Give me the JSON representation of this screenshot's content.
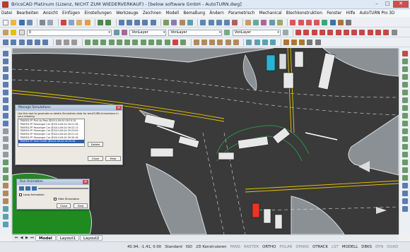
{
  "window": {
    "title": "BricsCAD Platinum (Lizenz, NICHT ZUM WIEDERVERKAUF) - [below software GmbH - AutoTURN.dwg]",
    "minimize_glyph": "–",
    "maximize_glyph": "□",
    "close_glyph": "✕"
  },
  "menu": [
    "Datei",
    "Bearbeiten",
    "Ansicht",
    "Einfügen",
    "Einstellungen",
    "Werkzeuge",
    "Zeichnen",
    "Modell",
    "Bemaßung",
    "Ändern",
    "Parametrisch",
    "Mechanical",
    "Blechkonstruktion",
    "Fenster",
    "Hilfe",
    "AutoTURN Pro 3D"
  ],
  "toolbar": {
    "layer_value": "0",
    "color_value": "VonLayer",
    "linetype_value": "VonLayer",
    "lineweight_value": "VonLayer"
  },
  "dialog_simulations": {
    "title": "Manage Simulations",
    "close_glyph": "✕",
    "description": "Use this tool to generate or delete Simulation data for AutoTURN Animations in your drawing.",
    "items": [
      "TRAREG-PF Pick Up Pass @2014-09-04 09:19:10",
      "TRAREG-PF Passenger Car @2014-09-04 09:21:38",
      "TRAREG-PF Passenger Car @2014-09-04 09:22:13",
      "TRAREG-PF Passenger Car @2014-09-04 09:23:09",
      "TRAREG-PF Passenger Car @2014-09-04 09:21:14",
      "TRAREG-PF Passenger Car @2014-09-04 09:30:16",
      "TRAREG-PF Semi Trailer @2014-09-04 09:35:16"
    ],
    "selected_index": 6,
    "buttons": [
      "Delete",
      "Close",
      "Help"
    ]
  },
  "dialog_animation": {
    "title": "Run Animation",
    "close_glyph": "✕",
    "loop_label": "Loop Animation",
    "hide_label": "Hide Simulation",
    "buttons": [
      "Close",
      "Help"
    ]
  },
  "tabs": {
    "nav": [
      "⏮",
      "◀",
      "▶",
      "⏭"
    ],
    "items": [
      "Model",
      "Layout1",
      "Layout2"
    ],
    "active": "Model"
  },
  "status": {
    "coords": "40.94, -1.41, 0.00",
    "items": [
      "Standard",
      "ISO",
      "2D Konstruieren",
      "FANG",
      "RASTER",
      "ORTHO",
      "POLAR",
      "OFANG",
      "OTRACK",
      "LST",
      "MODELL",
      "DBKS",
      "DYN",
      "QUAD"
    ],
    "dim_items": [
      "FANG",
      "RASTER",
      "POLAR",
      "OFANG",
      "LST",
      "DYN",
      "QUAD"
    ]
  },
  "colors": {
    "asphalt": "#3a3a3a",
    "island": "#8a9094",
    "curb": "#d9dde0",
    "lane_yellow": "#e8c800",
    "grass": "#1f8a1f",
    "selected": "#2f5fa8"
  }
}
